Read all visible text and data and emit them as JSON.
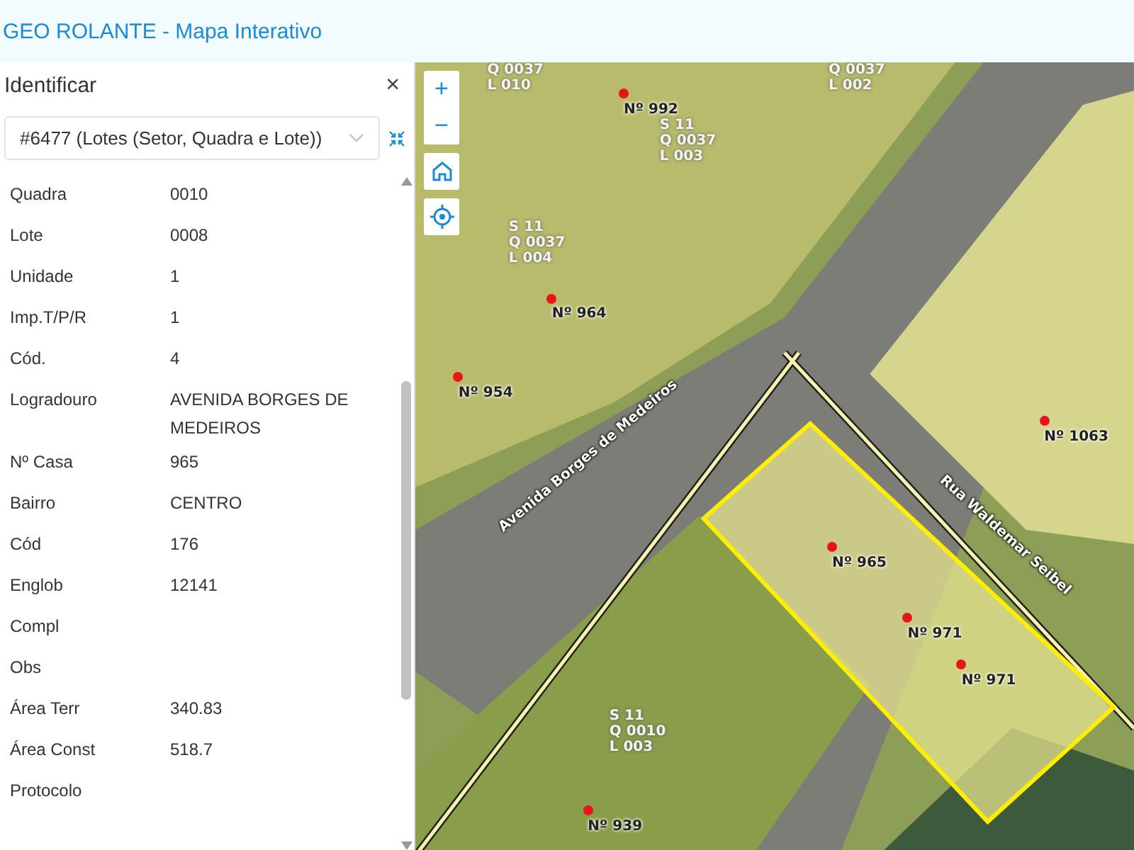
{
  "header": {
    "title": "GEO ROLANTE - Mapa Interativo"
  },
  "panel": {
    "title": "Identificar",
    "close": "×",
    "select": {
      "value": "#6477 (Lotes (Setor, Quadra e Lote))"
    },
    "fields": [
      {
        "label": "Quadra",
        "value": "0010"
      },
      {
        "label": "Lote",
        "value": "0008"
      },
      {
        "label": "Unidade",
        "value": "1"
      },
      {
        "label": "Imp.T/P/R",
        "value": "1"
      },
      {
        "label": "Cód.",
        "value": "4"
      },
      {
        "label": "Logradouro",
        "value": "AVENIDA BORGES DE MEDEIROS"
      },
      {
        "label": "Nº Casa",
        "value": "965"
      },
      {
        "label": "Bairro",
        "value": "CENTRO"
      },
      {
        "label": "Cód",
        "value": "176"
      },
      {
        "label": "Englob",
        "value": "12141"
      },
      {
        "label": "Compl"
      },
      {
        "label": "Obs"
      },
      {
        "label": "Área Terr",
        "value": "340.83"
      },
      {
        "label": "Área Const",
        "value": "518.7"
      },
      {
        "label": "Protocolo"
      }
    ]
  },
  "map": {
    "controls": [
      {
        "kind": "zoom-in",
        "label": "+"
      },
      {
        "kind": "zoom-out",
        "label": "−"
      },
      {
        "kind": "home"
      },
      {
        "kind": "locate"
      }
    ],
    "labels": [
      {
        "kind": "lot",
        "text": "Q 0037\nL 010"
      },
      {
        "kind": "lot",
        "text": "Q 0037\nL 002"
      },
      {
        "kind": "number",
        "text": "Nº 992"
      },
      {
        "kind": "lot",
        "text": "S 11\nQ 0037\nL 003"
      },
      {
        "kind": "lot",
        "text": "S 11\nQ 0037\nL 004"
      },
      {
        "kind": "number",
        "text": "Nº 964"
      },
      {
        "kind": "number",
        "text": "Nº 954"
      },
      {
        "kind": "number",
        "text": "Nº 1063"
      },
      {
        "kind": "number",
        "text": "Nº 965"
      },
      {
        "kind": "number",
        "text": "Nº 971"
      },
      {
        "kind": "number",
        "text": "Nº 971"
      },
      {
        "kind": "lot",
        "text": "S 11\nQ 0010\nL 003"
      },
      {
        "kind": "number",
        "text": "Nº 939"
      }
    ],
    "streets": [
      {
        "text": "Avenida Borges de Medeiros"
      },
      {
        "text": "Rua Waldemar Seibel"
      }
    ]
  }
}
